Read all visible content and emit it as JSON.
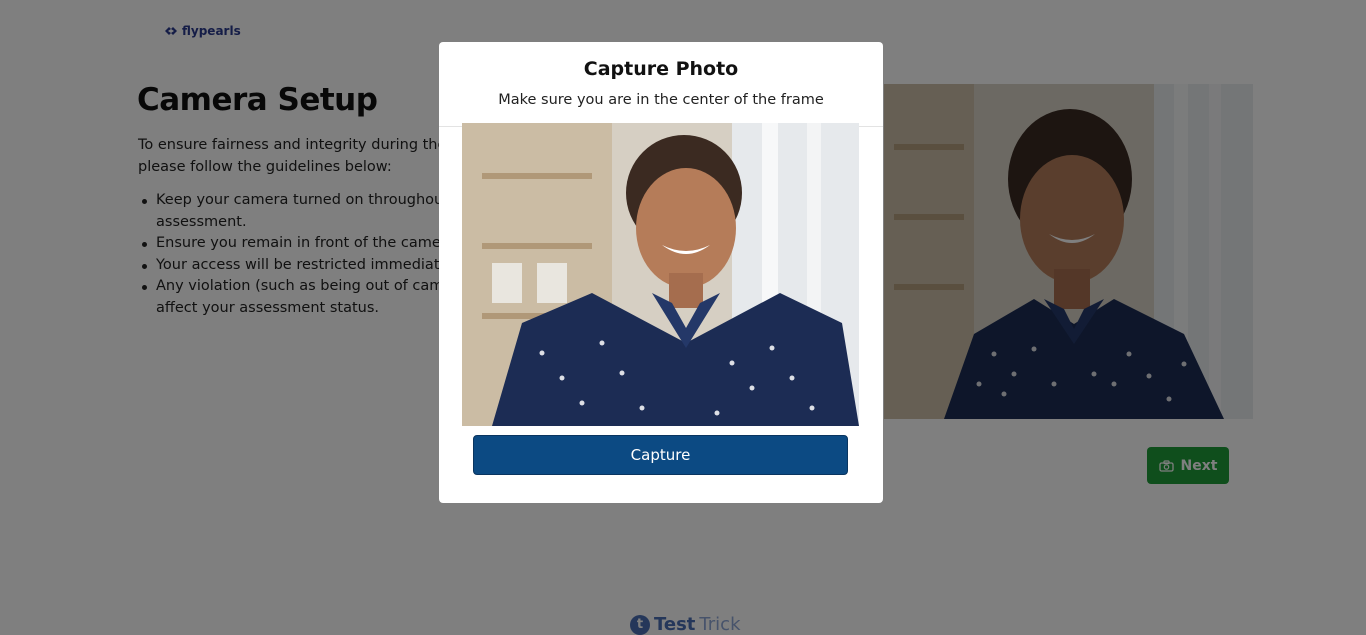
{
  "brand": {
    "name": "flypearls"
  },
  "page": {
    "title": "Camera Setup",
    "intro": "To ensure fairness and integrity during the assessment, please follow the guidelines below:",
    "rules": [
      "Keep your camera turned on throughout the assessment.",
      "Ensure you remain in front of the camera.",
      "Your access will be restricted immediately.",
      "Any violation (such as being out of camera view) may affect your assessment status."
    ],
    "next_label": "Next"
  },
  "footer": {
    "brand_bold": "Test",
    "brand_light": "Trick"
  },
  "modal": {
    "title": "Capture Photo",
    "subtitle": "Make sure you are in the center of the frame",
    "capture_label": "Capture"
  },
  "colors": {
    "accent_blue": "#0c4a83",
    "next_green": "#1f9d38",
    "brand_blue": "#2b3a8f"
  },
  "icons": {
    "logo": "flypearls-logo-icon",
    "next": "camera-icon",
    "footer": "testtrick-logo-icon"
  }
}
